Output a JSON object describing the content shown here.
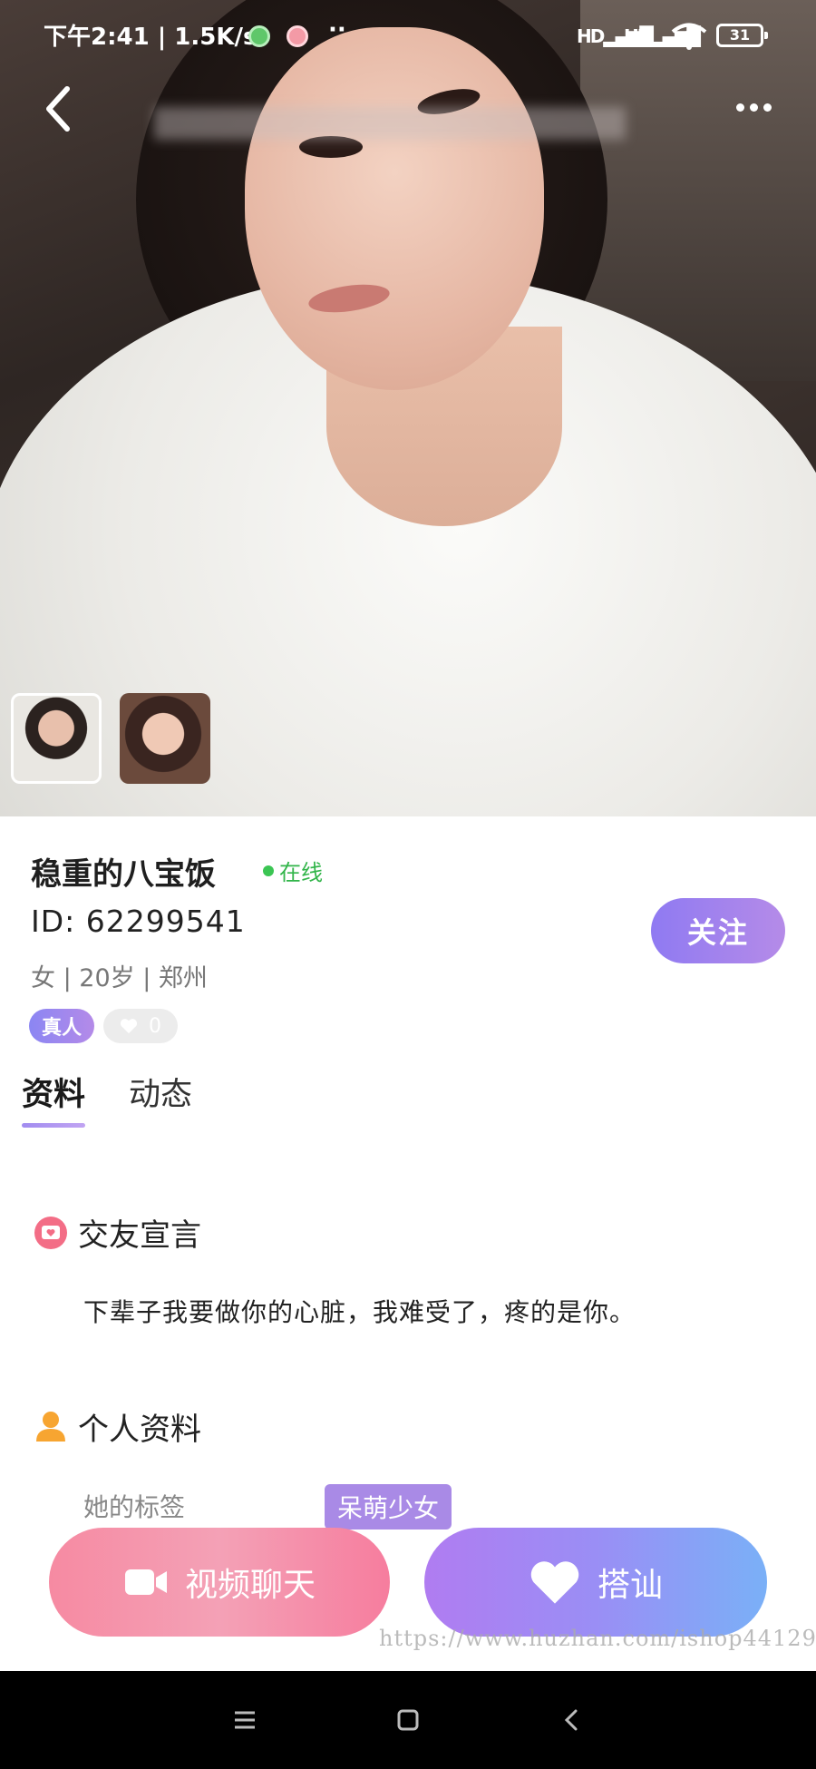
{
  "status_bar": {
    "time": "下午2:41 | 1.5K/s",
    "more": "··",
    "signal_1": "HD",
    "signal_2": "HD",
    "battery": "31"
  },
  "profile": {
    "nickname": "稳重的八宝饭",
    "online_status": "在线",
    "id_label": "ID: 62299541",
    "meta": "女 | 20岁 | 郑州",
    "follow_label": "关注",
    "badge_real": "真人",
    "likes": "0"
  },
  "tabs": [
    {
      "label": "资料",
      "active": true
    },
    {
      "label": "动态",
      "active": false
    }
  ],
  "sections": {
    "declaration_title": "交友宣言",
    "declaration_text": "下辈子我要做你的心脏，我难受了，疼的是你。",
    "personal_title": "个人资料",
    "tag_label": "她的标签",
    "tag_value": "呆萌少女"
  },
  "actions": {
    "video_label": "视频聊天",
    "chat_label": "搭讪"
  },
  "watermark": "https://www.huzhan.com/ishop44129",
  "colors": {
    "accent_purple": "#9b83f0",
    "online_green": "#32b54a",
    "pink": "#f68aa2",
    "blue": "#7ab0f7"
  },
  "icons": [
    "back-icon",
    "more-icon",
    "wifi-icon",
    "video-camera-icon",
    "heart-icon",
    "declaration-icon",
    "person-icon",
    "nav-menu-icon",
    "nav-home-icon",
    "nav-back-icon"
  ]
}
